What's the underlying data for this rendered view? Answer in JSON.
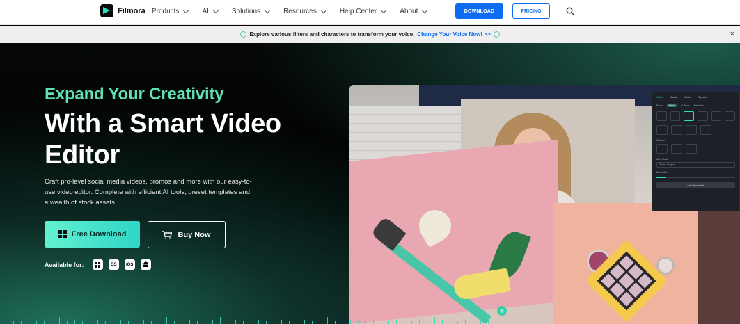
{
  "nav": {
    "logo_text": "Filmora",
    "items": [
      {
        "label": "Products"
      },
      {
        "label": "AI"
      },
      {
        "label": "Solutions"
      },
      {
        "label": "Resources"
      },
      {
        "label": "Help Center"
      },
      {
        "label": "About"
      }
    ],
    "download_label": "DOWNLOAD",
    "pricing_label": "PRICING"
  },
  "banner": {
    "text": "Explore various filters and characters to transform your voice.",
    "link": "Change Your Voice Now! >>",
    "close": "×"
  },
  "hero": {
    "kicker": "Expand Your Creativity",
    "title": "With a Smart Video Editor",
    "description": "Craft pro-level social media videos, promos and more with our easy-to-use video editor. Complete with efficient AI tools, preset templates and a wealth of stock assets.",
    "free_download_label": "Free Download",
    "buy_now_label": "Buy Now",
    "available_label": "Available for:",
    "platforms": [
      "windows-icon",
      "macos-icon",
      "ios-icon",
      "android-icon"
    ],
    "platform_text": {
      "macos": "OS",
      "ios": "iOS"
    }
  },
  "editor_panel": {
    "tabs": [
      "Video",
      "Audio",
      "Color",
      "Speed"
    ],
    "subtabs": [
      "Basic",
      "Mask",
      "AI Tools",
      "Animation"
    ],
    "section_custom": "Custom",
    "auto_mask": "Auto Mask",
    "select_subject": "Select Subject",
    "brush_size": "Brush Size",
    "brush_value": "30",
    "add_button": "Add Draw Mask"
  },
  "colors": {
    "accent": "#5fe0b7",
    "primary": "#0c6cf2",
    "cta": "#4fe5cc"
  }
}
